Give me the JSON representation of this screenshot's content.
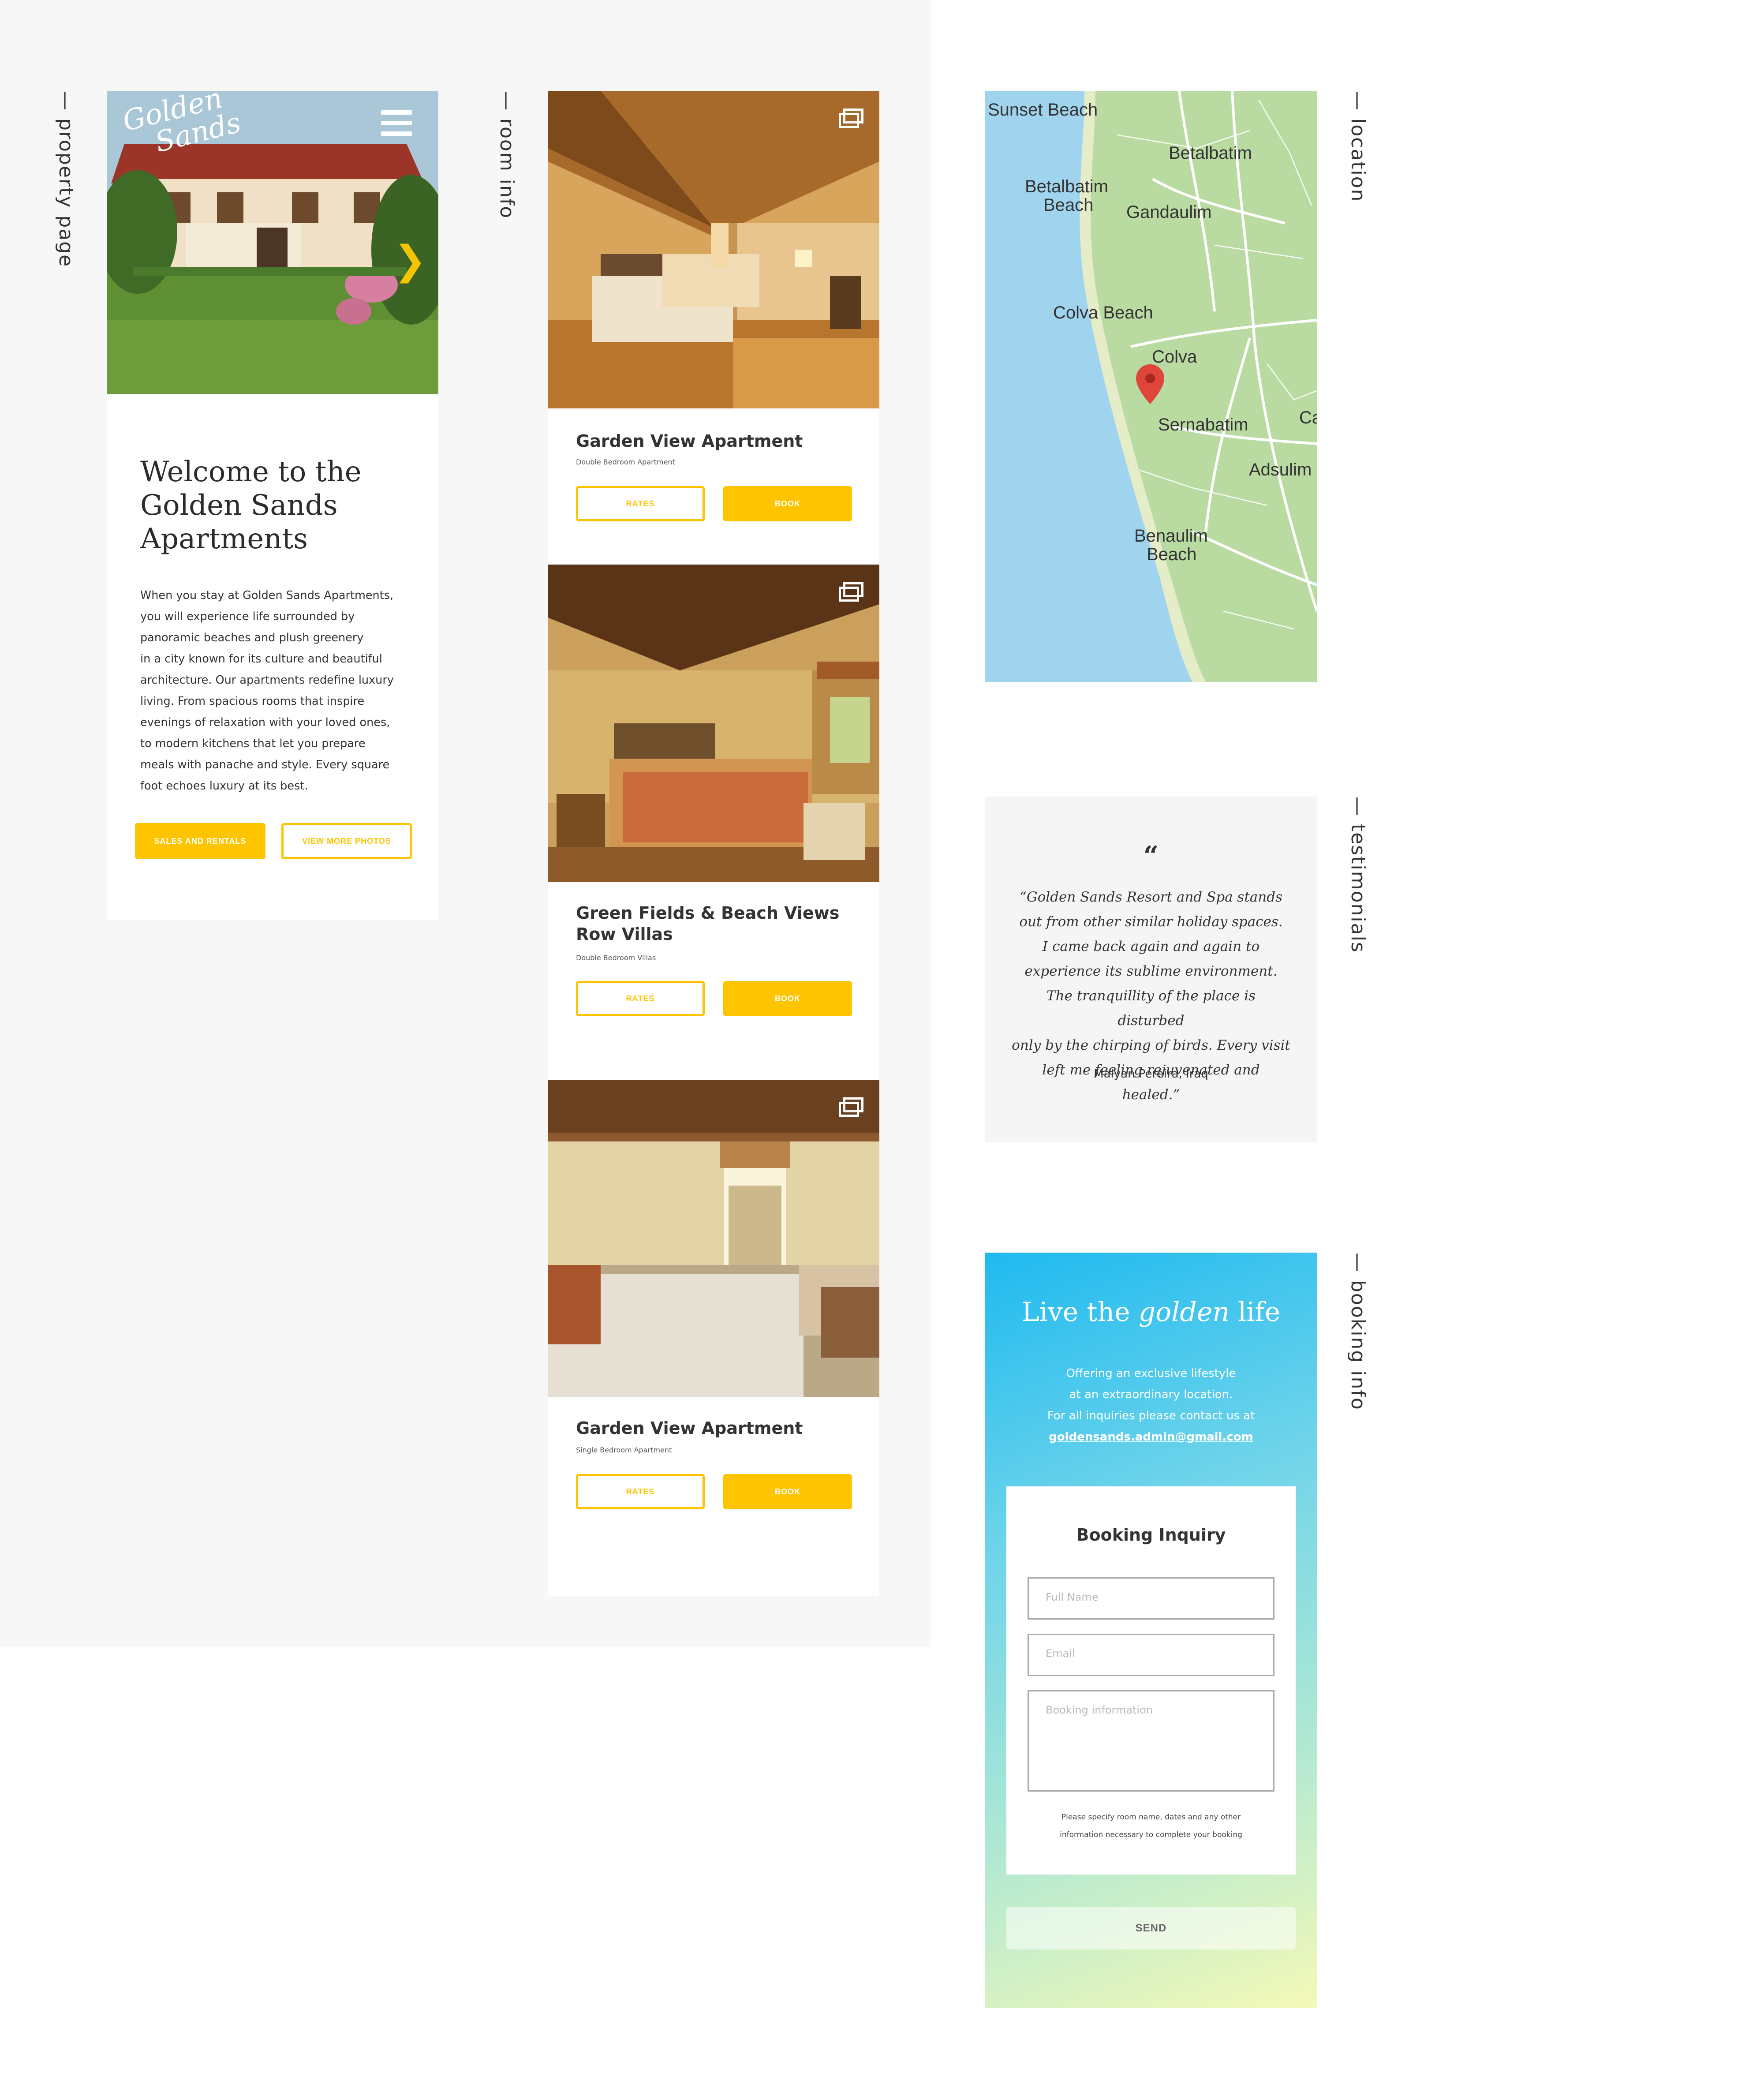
{
  "section_labels": {
    "property": "— property page",
    "rooms": "— room info",
    "location": "— location",
    "testimonials": "— testimonials",
    "booking": "— booking info"
  },
  "property": {
    "logo_line1": "Golden",
    "logo_line2": "Sands",
    "menu_icon": "hamburger-menu-icon",
    "next_icon": "chevron-right-icon",
    "title": "Welcome to the Golden Sands Apartments",
    "body_lines": [
      "When you stay at Golden Sands Apartments,",
      "you will experience life surrounded by",
      "panoramic beaches and plush greenery",
      "in a city known for its culture and beautiful",
      "architecture. Our apartments redefine luxury",
      "living. From spacious rooms that inspire",
      "evenings of relaxation with your loved ones,",
      "to modern kitchens that let you prepare",
      "meals with panache and style. Every square",
      "foot echoes luxury at its best."
    ],
    "primary_button": "SALES AND RENTALS",
    "secondary_button": "VIEW MORE PHOTOS",
    "accent_color": "#ffc400"
  },
  "rooms": [
    {
      "title": "Garden View Apartment",
      "subtitle": "Double Bedroom Apartment",
      "rates": "RATES",
      "book": "BOOK"
    },
    {
      "title": "Green Fields & Beach Views Row Villas",
      "subtitle": "Double Bedroom Villas",
      "rates": "RATES",
      "book": "BOOK"
    },
    {
      "title": "Garden View Apartment",
      "subtitle": "Single Bedroom Apartment",
      "rates": "RATES",
      "book": "BOOK"
    }
  ],
  "map": {
    "labels": {
      "sunset": "Sunset Beach",
      "betalbatim": "Betalbatim",
      "betalbatim_beach_1": "Betalbatim",
      "betalbatim_beach_2": "Beach",
      "gandaulim": "Gandaulim",
      "colva_beach": "Colva Beach",
      "colva": "Colva",
      "sernabatim": "Sernabatim",
      "ca": "Ca",
      "adsulim": "Adsulim",
      "benaulim_1": "Benaulim",
      "benaulim_2": "Beach"
    },
    "pin_icon": "map-pin-icon",
    "sea_color": "#9fd3ee",
    "land_color": "#b7d9a0"
  },
  "testimonial": {
    "quote_mark": "“",
    "lines": [
      "“Golden Sands Resort and Spa stands",
      "out from other similar holiday spaces.",
      "I came back again and again to",
      "experience its sublime environment.",
      "The tranquillity of the place is disturbed",
      "only by the chirping of birds.  Every visit",
      "left me feeling rejuvenated and healed.”"
    ],
    "author": "Malyan Pereira, Iraq"
  },
  "booking": {
    "title_pre": "Live the ",
    "title_em": "golden",
    "title_post": " life",
    "info_line1": "Offering an exclusive lifestyle",
    "info_line2": "at an extraordinary location.",
    "info_line3": "For all inquiries please contact us at",
    "email": "goldensands.admin@gmail.com",
    "form_title": "Booking Inquiry",
    "name_placeholder": "Full Name",
    "email_placeholder": "Email",
    "info_placeholder": "Booking information",
    "note_line1": "Please specify room name, dates and any other",
    "note_line2": "information necessary to complete your booking",
    "send": "SEND"
  }
}
